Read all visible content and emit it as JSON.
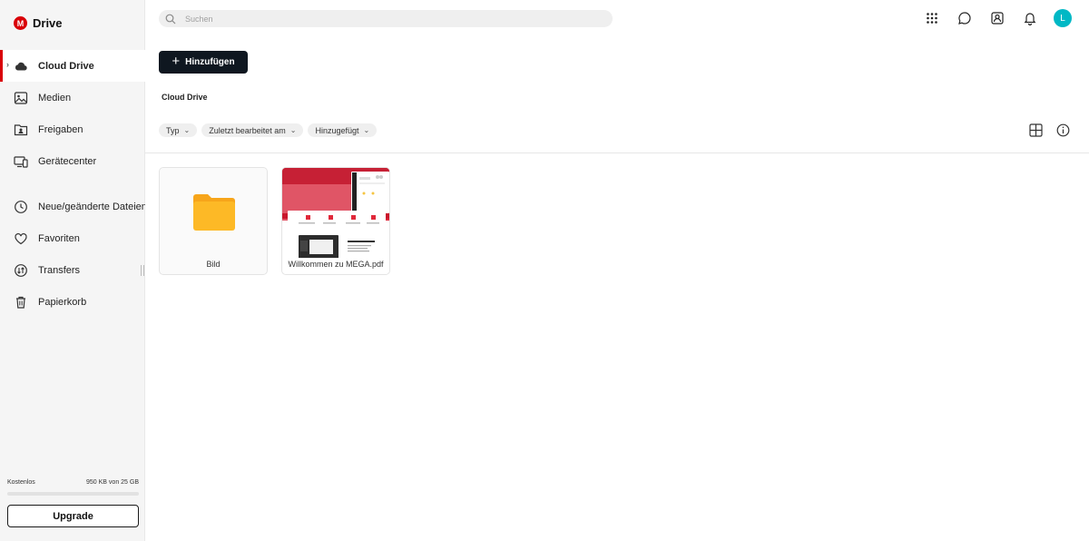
{
  "brand": {
    "logo_letter": "M",
    "title": "Drive",
    "color": "#d90007"
  },
  "sidebar": {
    "items": [
      {
        "label": "Cloud Drive",
        "icon": "cloud-icon",
        "active": true
      },
      {
        "label": "Medien",
        "icon": "image-icon"
      },
      {
        "label": "Freigaben",
        "icon": "shared-folder-icon"
      },
      {
        "label": "Gerätecenter",
        "icon": "devices-icon"
      },
      {
        "label": "Neue/geänderte Dateien",
        "icon": "clock-icon"
      },
      {
        "label": "Favoriten",
        "icon": "heart-icon"
      },
      {
        "label": "Transfers",
        "icon": "transfer-icon"
      },
      {
        "label": "Papierkorb",
        "icon": "trash-icon"
      }
    ],
    "storage": {
      "plan": "Kostenlos",
      "usage": "950 KB von 25 GB",
      "fraction": 4e-05
    },
    "upgrade_label": "Upgrade"
  },
  "search": {
    "placeholder": "Suchen"
  },
  "header": {
    "avatar_letter": "L",
    "avatar_color": "#00b8c5"
  },
  "toolbar": {
    "add_label": "Hinzufügen"
  },
  "breadcrumb": "Cloud Drive",
  "filters": [
    {
      "label": "Typ"
    },
    {
      "label": "Zuletzt bearbeitet am"
    },
    {
      "label": "Hinzugefügt"
    }
  ],
  "items": [
    {
      "name": "Bild",
      "type": "folder"
    },
    {
      "name": "Willkommen zu MEGA.pdf",
      "type": "pdf"
    }
  ],
  "thumbnail": {
    "heading": "Willkommen zu MEGA",
    "section": "Transfer und Sync"
  }
}
